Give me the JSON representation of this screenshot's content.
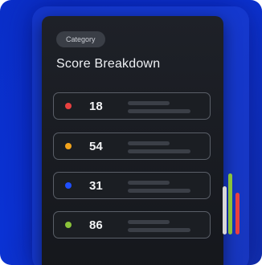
{
  "card": {
    "category_label": "Category",
    "title": "Score Breakdown"
  },
  "scores": [
    {
      "value": "18",
      "color": "#e8403f"
    },
    {
      "value": "54",
      "color": "#f2a31b"
    },
    {
      "value": "31",
      "color": "#1f4fff"
    },
    {
      "value": "86",
      "color": "#8ac23a"
    }
  ],
  "side_bars": {
    "colors": [
      "#d9d9d9",
      "#8ac23a",
      "#e8403f"
    ]
  }
}
